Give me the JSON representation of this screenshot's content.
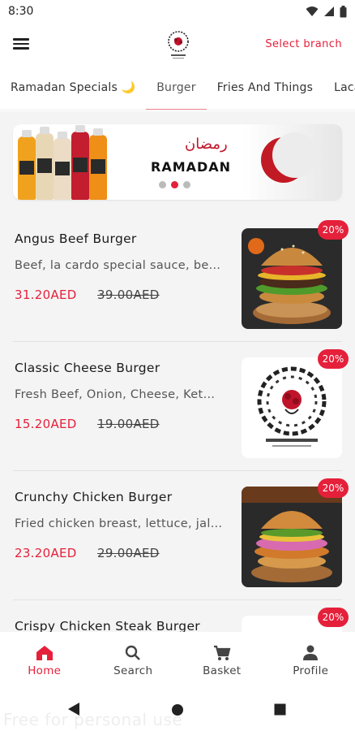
{
  "status_bar": {
    "time": "8:30"
  },
  "header": {
    "branch_label": "Select branch"
  },
  "tabs": [
    {
      "label": "Ramadan Specials 🌙"
    },
    {
      "label": "Burger"
    },
    {
      "label": "Fries And Things"
    },
    {
      "label": "Lacar"
    }
  ],
  "banner": {
    "arabic_text": "رمضان",
    "title": "RAMADAN"
  },
  "items": [
    {
      "name": "Angus Beef Burger",
      "description": "Beef, la cardo special sauce, be…",
      "price": "31.20AED",
      "old_price": "39.00AED",
      "discount": "20%"
    },
    {
      "name": "Classic Cheese Burger",
      "description": "Fresh Beef, Onion, Cheese, Ket…",
      "price": "15.20AED",
      "old_price": "19.00AED",
      "discount": "20%"
    },
    {
      "name": "Crunchy Chicken Burger",
      "description": "Fried chicken breast, lettuce, jal…",
      "price": "23.20AED",
      "old_price": "29.00AED",
      "discount": "20%"
    },
    {
      "name": "Crispy Chicken Steak Burger",
      "description": "",
      "price": "",
      "old_price": "",
      "discount": "20%"
    }
  ],
  "bottom_nav": [
    {
      "label": "Home",
      "icon": "home-icon"
    },
    {
      "label": "Search",
      "icon": "search-icon"
    },
    {
      "label": "Basket",
      "icon": "cart-icon"
    },
    {
      "label": "Profile",
      "icon": "person-icon"
    }
  ],
  "watermark": "Free for personal use",
  "colors": {
    "accent": "#e5203a",
    "background": "#f4f4f4"
  }
}
